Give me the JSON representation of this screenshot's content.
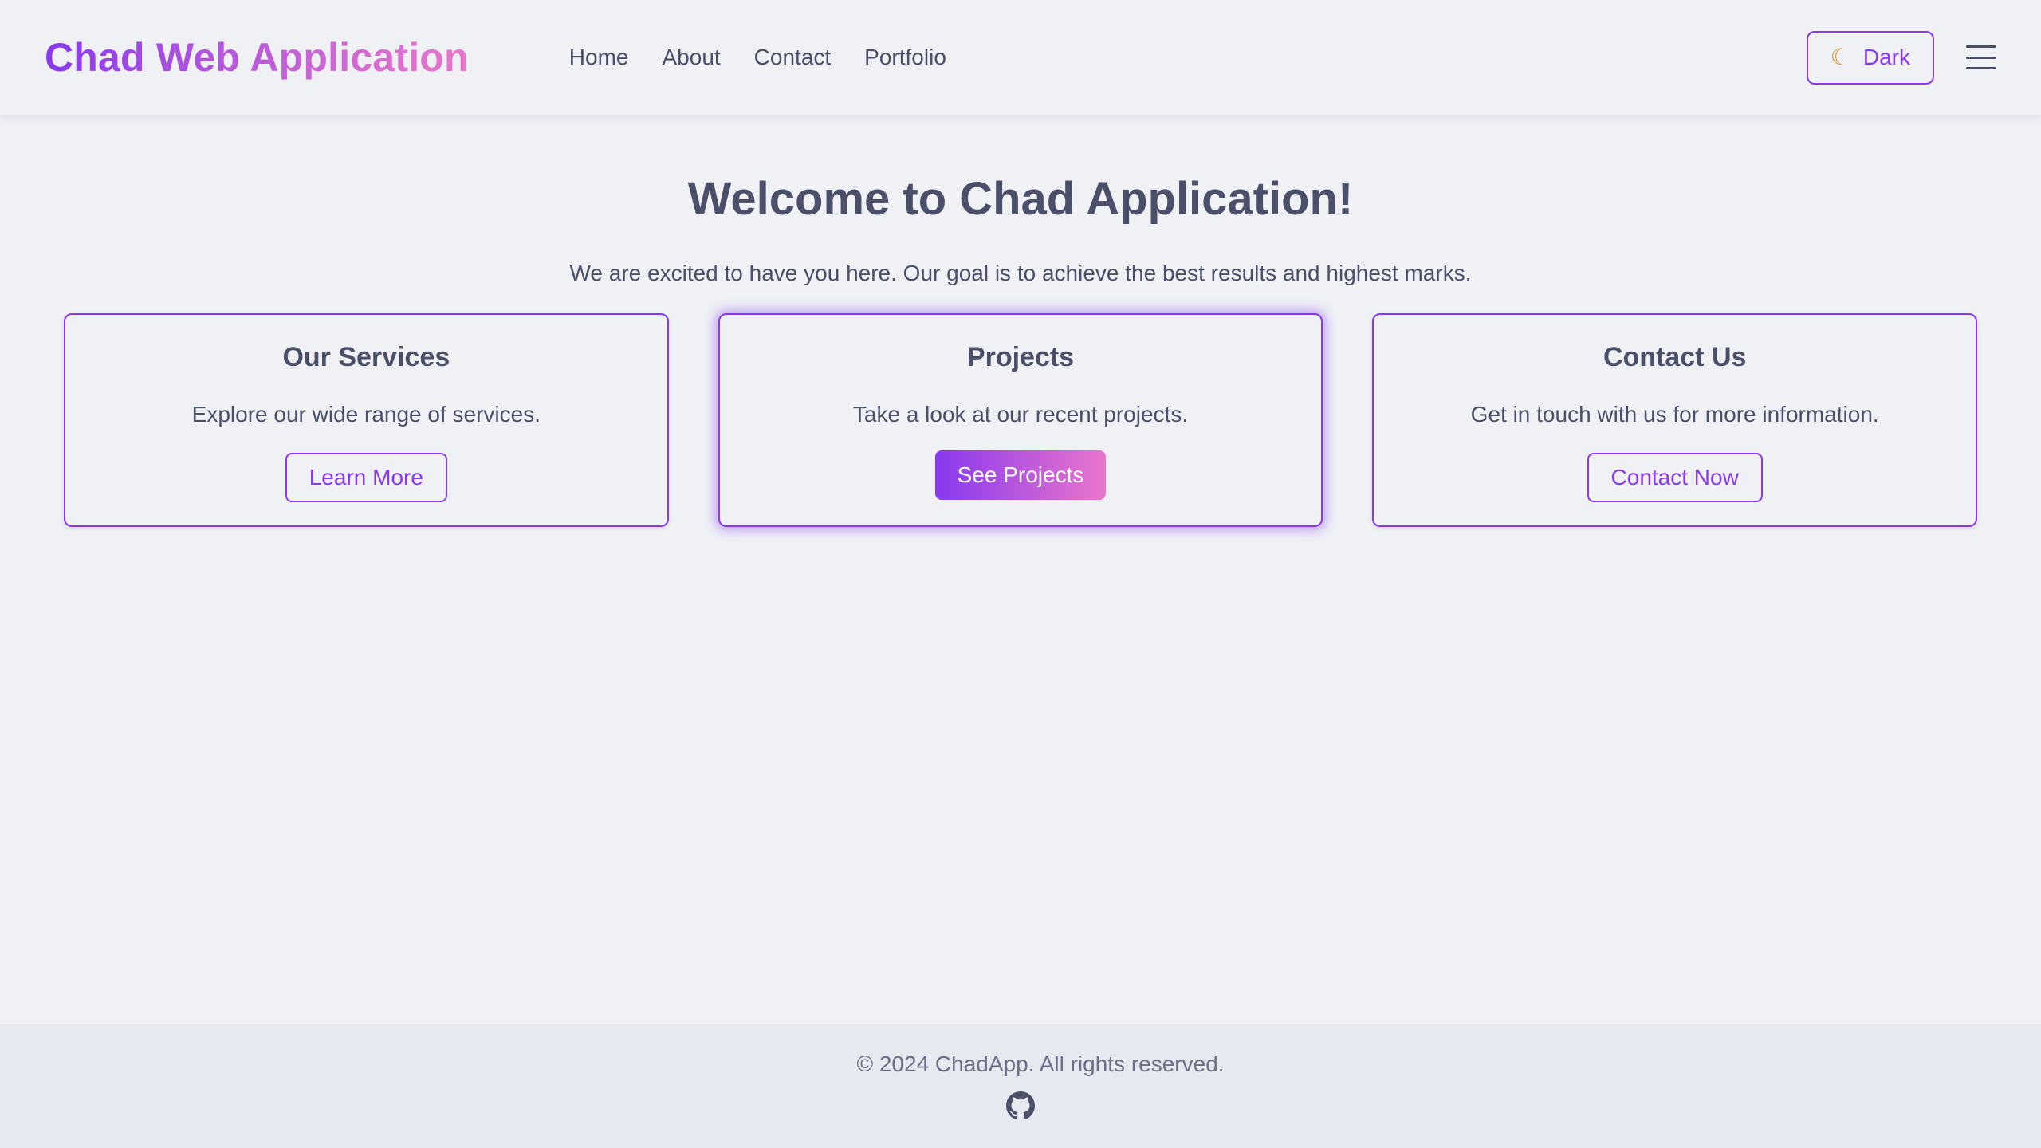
{
  "header": {
    "logo": "Chad Web Application",
    "nav": [
      "Home",
      "About",
      "Contact",
      "Portfolio"
    ],
    "theme_toggle": {
      "icon": "moon-icon",
      "label": "Dark"
    },
    "menu_icon": "hamburger-menu-icon"
  },
  "hero": {
    "title": "Welcome to Chad Application!",
    "subtitle": "We are excited to have you here. Our goal is to achieve the best results and highest marks."
  },
  "cards": [
    {
      "title": "Our Services",
      "text": "Explore our wide range of services.",
      "button": "Learn More"
    },
    {
      "title": "Projects",
      "text": "Take a look at our recent projects.",
      "button": "See Projects"
    },
    {
      "title": "Contact Us",
      "text": "Get in touch with us for more information.",
      "button": "Contact Now"
    }
  ],
  "footer": {
    "copyright": "© 2024 ChadApp. All rights reserved.",
    "icon": "github-icon"
  },
  "colors": {
    "accent": "#8839ef",
    "accent_pink": "#ea76cb",
    "text": "#4c4f69",
    "background": "#eff1f5",
    "footer_background": "#e6e9ef"
  }
}
